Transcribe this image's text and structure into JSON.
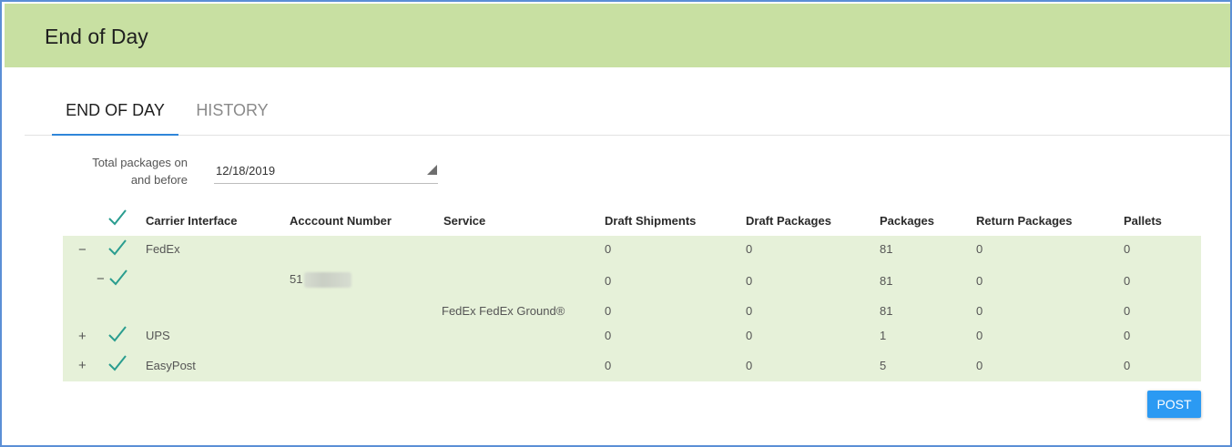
{
  "header": {
    "title": "End of Day"
  },
  "tabs": [
    {
      "label": "END OF DAY",
      "active": true
    },
    {
      "label": "HISTORY",
      "active": false
    }
  ],
  "filter": {
    "label": "Total packages on and before",
    "date": "12/18/2019"
  },
  "table": {
    "columns": [
      "Carrier Interface",
      "Acccount Number",
      "Service",
      "Draft Shipments",
      "Draft Packages",
      "Packages",
      "Return Packages",
      "Pallets"
    ],
    "rows": [
      {
        "toggle": "−",
        "checked": true,
        "carrier": "FedEx",
        "account": "",
        "service": "",
        "draft_shipments": "0",
        "draft_packages": "0",
        "packages": "81",
        "return_packages": "0",
        "pallets": "0"
      },
      {
        "toggle": "−",
        "checked": true,
        "carrier": "",
        "account": "51",
        "service": "",
        "draft_shipments": "0",
        "draft_packages": "0",
        "packages": "81",
        "return_packages": "0",
        "pallets": "0"
      },
      {
        "toggle": "",
        "checked": false,
        "carrier": "",
        "account": "",
        "service": "FedEx FedEx Ground®",
        "draft_shipments": "0",
        "draft_packages": "0",
        "packages": "81",
        "return_packages": "0",
        "pallets": "0"
      },
      {
        "toggle": "+",
        "checked": true,
        "carrier": "UPS",
        "account": "",
        "service": "",
        "draft_shipments": "0",
        "draft_packages": "0",
        "packages": "1",
        "return_packages": "0",
        "pallets": "0"
      },
      {
        "toggle": "+",
        "checked": true,
        "carrier": "EasyPost",
        "account": "",
        "service": "",
        "draft_shipments": "0",
        "draft_packages": "0",
        "packages": "5",
        "return_packages": "0",
        "pallets": "0"
      }
    ]
  },
  "actions": {
    "post_label": "POST"
  },
  "colors": {
    "header_bg": "#c8e0a2",
    "row_bg": "#e6f1d9",
    "accent": "#2b9af3",
    "check": "#2a9d8f",
    "frame_border": "#5b8fd6"
  },
  "icons": {
    "check": "checkmark-icon",
    "collapse": "minus-icon",
    "expand": "plus-icon",
    "caret": "dropdown-caret-icon"
  }
}
